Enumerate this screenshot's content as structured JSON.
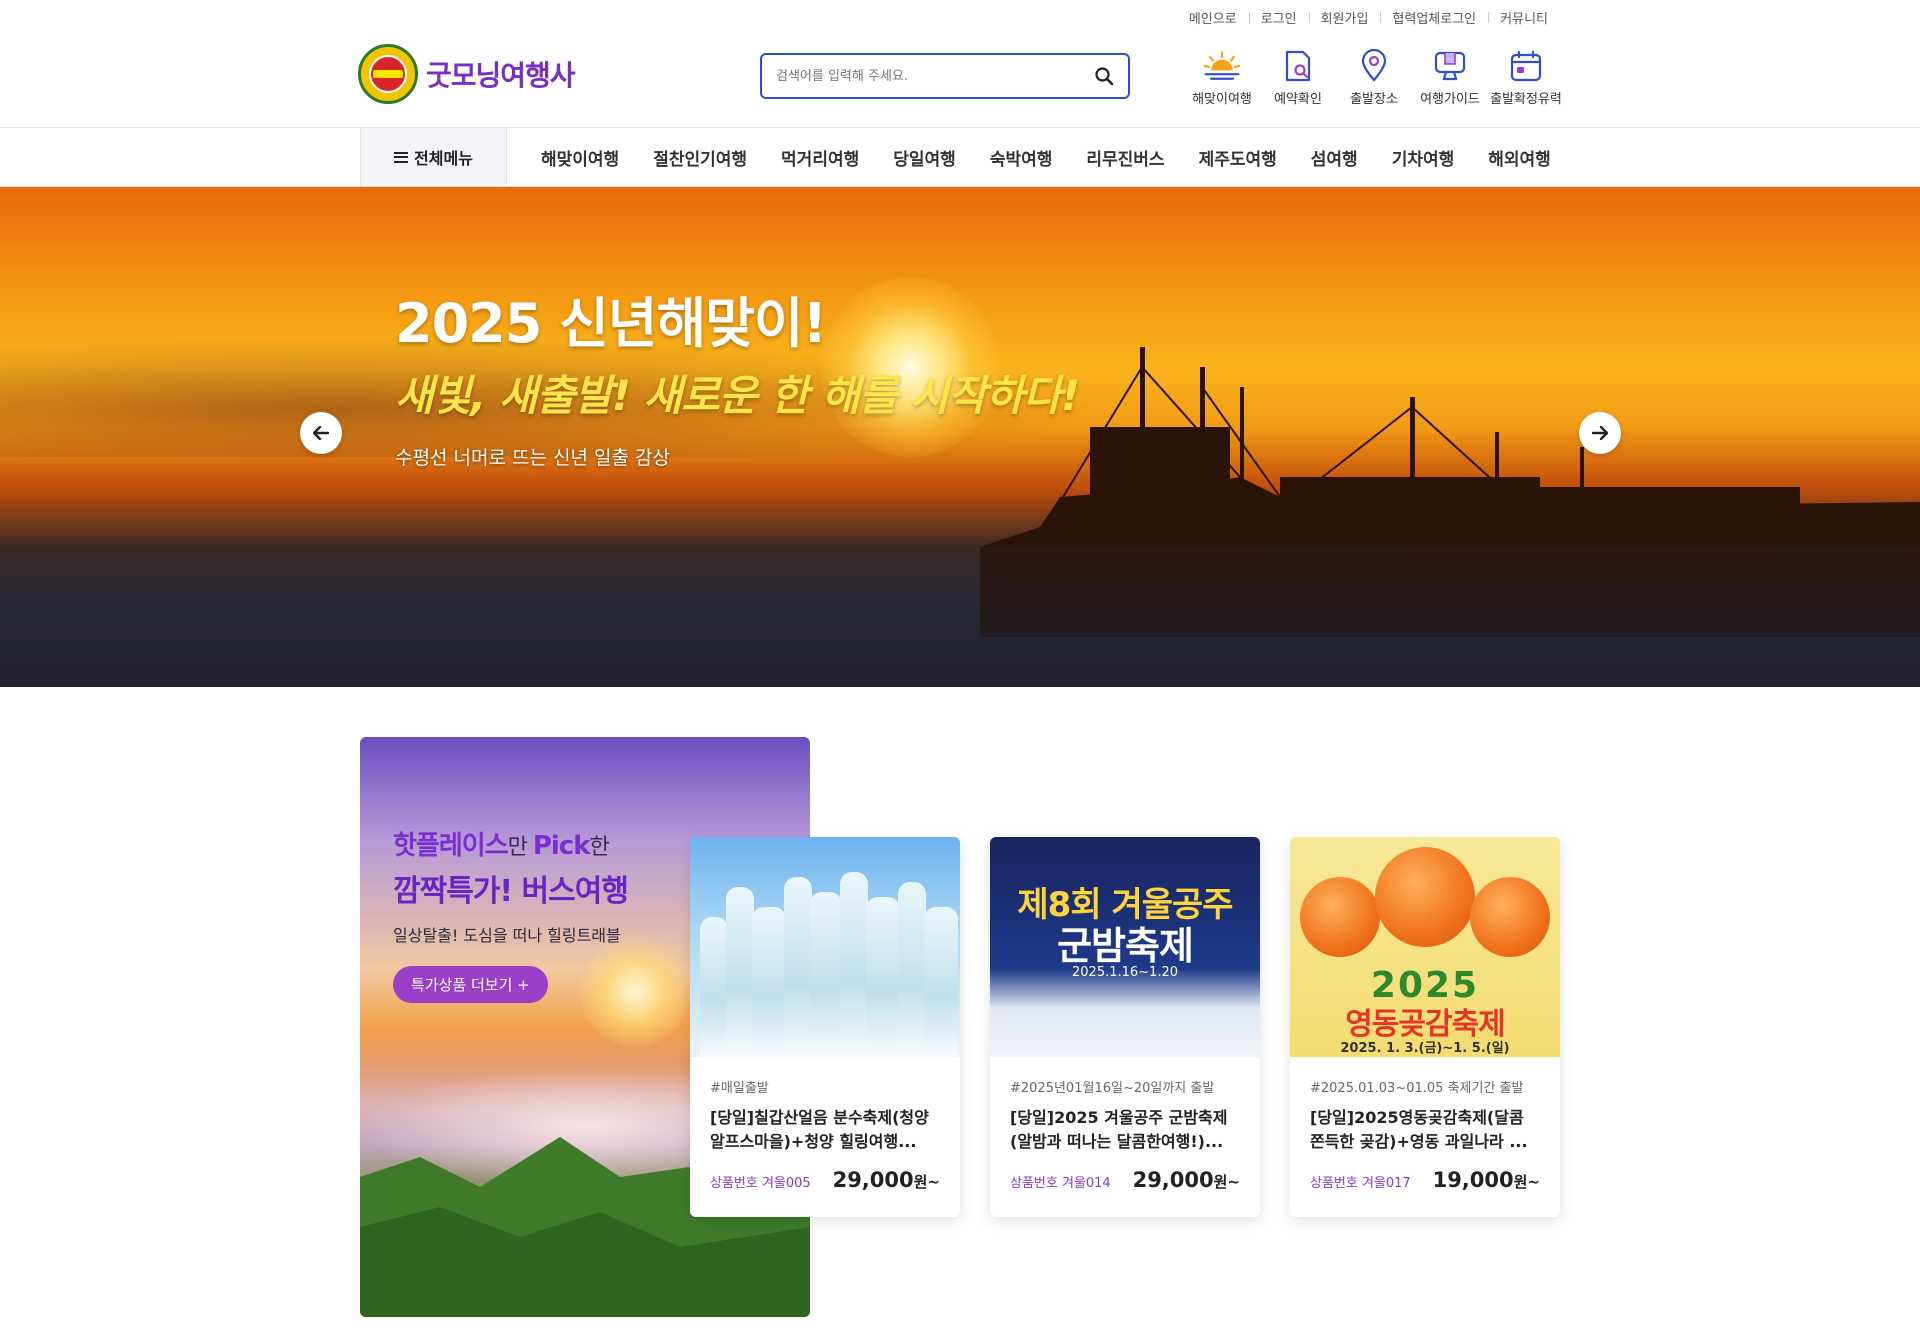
{
  "top_links": [
    "메인으로",
    "로그인",
    "회원가입",
    "협력업체로그인",
    "커뮤니티"
  ],
  "logo": {
    "name": "굿모닝여행사"
  },
  "search": {
    "placeholder": "검색어를 입력해 주세요."
  },
  "quick_menu": [
    {
      "label": "해맞이여행",
      "icon": "sunrise-icon"
    },
    {
      "label": "예약확인",
      "icon": "document-search-icon"
    },
    {
      "label": "출발장소",
      "icon": "location-pin-icon"
    },
    {
      "label": "여행가이드",
      "icon": "monitor-icon"
    },
    {
      "label": "출발확정유력",
      "icon": "calendar-icon"
    }
  ],
  "nav": {
    "all_menu": "전체메뉴",
    "items": [
      "해맞이여행",
      "절찬인기여행",
      "먹거리여행",
      "당일여행",
      "숙박여행",
      "리무진버스",
      "제주도여행",
      "섬여행",
      "기차여행",
      "해외여행"
    ]
  },
  "hero": {
    "title": "2025 신년해맞이!",
    "subtitle": "새빛, 새출발! 새로운 한 해를 시작하다!",
    "desc": "수평선 너머로 뜨는 신년 일출 감상"
  },
  "promo": {
    "line1_strong": "핫플레이스",
    "line1_thin": "만 ",
    "line1_pick": "Pick",
    "line1_end": "한",
    "line2": "깜짝특가! 버스여행",
    "line3": "일상탈출! 도심을 떠나 힐링트래블",
    "button": "특가상품 더보기 +"
  },
  "products": [
    {
      "tag": "#매일출발",
      "title": "[당일]칠갑산얼음 분수축제(청양알프스마을)+청양 힐링여행...",
      "code": "상품번호 겨울005",
      "price": "29,000",
      "unit": "원~"
    },
    {
      "tag": "#2025년01월16일~20일까지 출발",
      "title": "[당일]2025 겨울공주 군밤축제(알밤과 떠나는 달콤한여행!)...",
      "code": "상품번호 겨울014",
      "price": "29,000",
      "unit": "원~",
      "poster": {
        "line1": "제8회 겨울공주",
        "line2": "군밤축제",
        "date": "2025.1.16~1.20"
      }
    },
    {
      "tag": "#2025.01.03~01.05 축제기간 출발",
      "title": "[당일]2025영동곶감축제(달콤 쫀득한 곶감)+영동 과일나라 ...",
      "code": "상품번호 겨울017",
      "price": "19,000",
      "unit": "원~",
      "poster": {
        "year": "2025",
        "title": "영동곶감축제",
        "date": "2025. 1. 3.(금)~1. 5.(일)"
      }
    }
  ],
  "colors": {
    "brand_purple": "#7a2ec4",
    "search_border": "#2f4fcf",
    "accent_yellow": "#ffe44a"
  }
}
